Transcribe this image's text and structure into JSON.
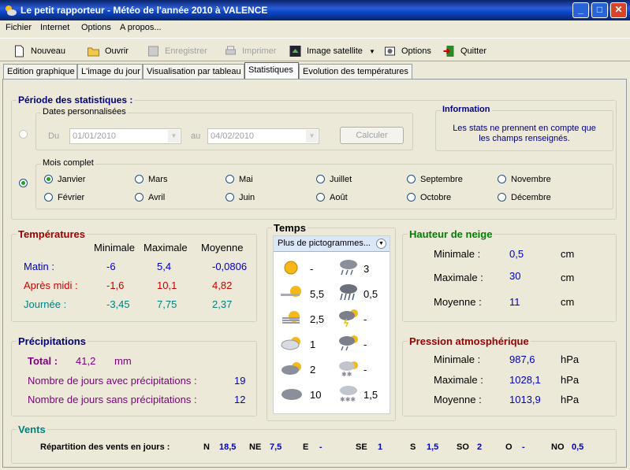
{
  "window": {
    "title": "Le petit rapporteur - Météo de l'année 2010 à VALENCE"
  },
  "menu": [
    "Fichier",
    "Internet",
    "Options",
    "A propos..."
  ],
  "toolbar": {
    "new": "Nouveau",
    "open": "Ouvrir",
    "save": "Enregistrer",
    "print": "Imprimer",
    "satellite": "Image satellite",
    "options": "Options",
    "quit": "Quitter"
  },
  "tabs": [
    "Edition graphique",
    "L'image du jour",
    "Visualisation par tableau",
    "Statistiques",
    "Evolution des températures"
  ],
  "periode": {
    "title": "Période des statistiques :",
    "dates_label": "Dates personnalisées",
    "du": "Du",
    "date_from": "01/01/2010",
    "au": "au",
    "date_to": "04/02/2010",
    "calc": "Calculer",
    "mois_label": "Mois complet",
    "months": [
      "Janvier",
      "Mars",
      "Mai",
      "Juillet",
      "Septembre",
      "Novembre",
      "Février",
      "Avril",
      "Juin",
      "Août",
      "Octobre",
      "Décembre"
    ]
  },
  "info": {
    "title": "Information",
    "text1": "Les stats ne prennent en compte que",
    "text2": "les champs renseignés."
  },
  "temperatures": {
    "title": "Températures",
    "h_min": "Minimale",
    "h_max": "Maximale",
    "h_moy": "Moyenne",
    "matin": "Matin :",
    "matin_min": "-6",
    "matin_max": "5,4",
    "matin_moy": "-0,0806",
    "apm": "Après midi :",
    "apm_min": "-1,6",
    "apm_max": "10,1",
    "apm_moy": "4,82",
    "journee": "Journée :",
    "j_min": "-3,45",
    "j_max": "7,75",
    "j_moy": "2,37"
  },
  "temps": {
    "title": "Temps",
    "dropdown": "Plus de pictogrammes...",
    "left": [
      "-",
      "5,5",
      "2,5",
      "1",
      "2",
      "10"
    ],
    "right": [
      "3",
      "0,5",
      "-",
      "-",
      "-",
      "1,5"
    ],
    "icons_left": [
      "sun-icon",
      "sun-cloud-icon",
      "sun-fog-icon",
      "cloud-sun-icon",
      "cloud-sun-dark-icon",
      "cloud-icon"
    ],
    "icons_right": [
      "rain-icon",
      "heavy-rain-icon",
      "storm-sun-icon",
      "rain-sun-icon",
      "snow-sun-icon",
      "snow-icon"
    ]
  },
  "neige": {
    "title": "Hauteur de neige",
    "min": "Minimale :",
    "min_v": "0,5",
    "max": "Maximale :",
    "max_v": "30",
    "moy": "Moyenne :",
    "moy_v": "11",
    "unit": "cm"
  },
  "precip": {
    "title": "Précipitations",
    "total": "Total :",
    "total_v": "41,2",
    "unit": "mm",
    "avec": "Nombre de jours avec précipitations :",
    "avec_v": "19",
    "sans": "Nombre de jours sans précipitations :",
    "sans_v": "12"
  },
  "pression": {
    "title": "Pression atmosphérique",
    "min": "Minimale :",
    "min_v": "987,6",
    "max": "Maximale :",
    "max_v": "1028,1",
    "moy": "Moyenne :",
    "moy_v": "1013,9",
    "unit": "hPa"
  },
  "vents": {
    "title": "Vents",
    "label": "Répartition des vents en jours :",
    "dirs": [
      "N",
      "NE",
      "E",
      "SE",
      "S",
      "SO",
      "O",
      "NO"
    ],
    "vals": [
      "18,5",
      "7,5",
      "-",
      "1",
      "1,5",
      "2",
      "-",
      "0,5"
    ]
  },
  "colors": {
    "accent": "#0a246a",
    "value": "#0000c0",
    "red": "#cc0000",
    "teal": "#008080",
    "purple": "#800080",
    "green": "#008000"
  }
}
